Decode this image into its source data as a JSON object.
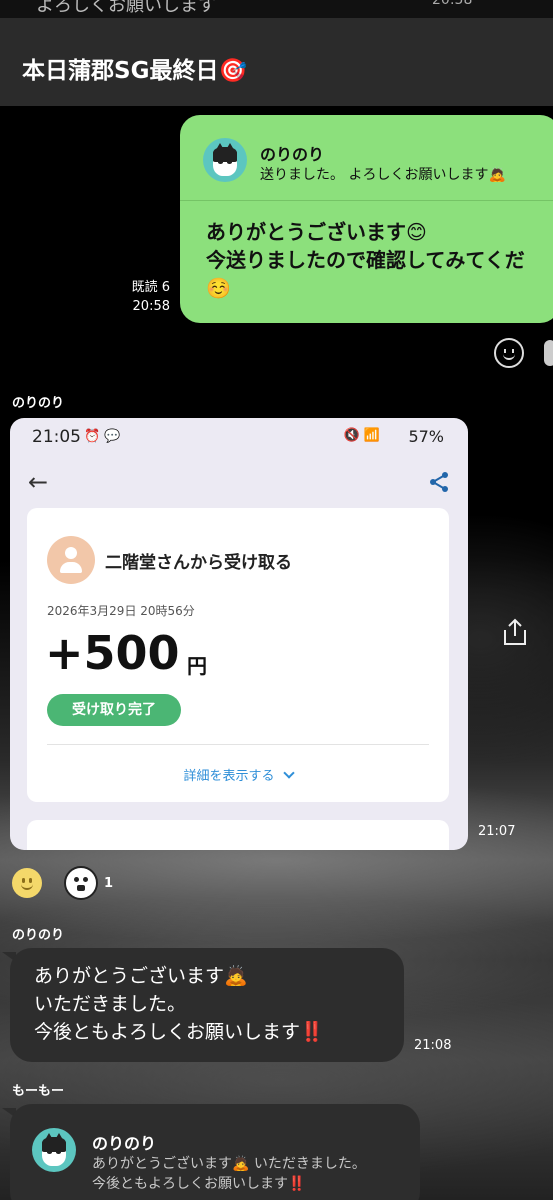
{
  "top_strip": {
    "clipped_text": "よろしくお願いします",
    "clipped_time": "20:58"
  },
  "header": {
    "title": "本日蒲郡SG最終日🎯"
  },
  "my_message": {
    "quote_name": "のりのり",
    "quote_text": "送りました。 よろしくお願いします🙇",
    "text": "ありがとうございます😊\n今送りましたので確認してみてくだ\n☺️",
    "read_label": "既読 6",
    "time": "20:58"
  },
  "messages": {
    "image_sender": "のりのり",
    "image_time": "21:07",
    "reaction_count": "1",
    "text_sender": "のりのり",
    "text": "ありがとうございます🙇\nいただきました。\n今後ともよろしくお願いします‼️",
    "text_time": "21:08",
    "quote_sender": "もーもー",
    "quote_name": "のりのり",
    "quote_text": "ありがとうございます🙇 いただきました。\n今後ともよろしくお願いします‼️"
  },
  "screenshot": {
    "status_time": "21:05",
    "status_left_icons": "⏰ 💬",
    "status_icons": "🔇 📶",
    "battery": "57%",
    "payer_text": "二階堂さんから受け取る",
    "date": "2026年3月29日 20時56分",
    "amount": "+500",
    "currency": "円",
    "status_chip": "受け取り完了",
    "details_link": "詳細を表示する"
  },
  "colors": {
    "my_bubble": "#8ce07c",
    "their_bubble": "#2d2d2d",
    "header": "#2b2b2b",
    "receipt_chip": "#4bb674",
    "link": "#2f8fd8"
  },
  "icons": [
    "cat-avatar-icon",
    "smile-reaction-icon",
    "share-icon",
    "upload-icon",
    "back-arrow-icon",
    "chevron-down-icon",
    "person-icon"
  ]
}
